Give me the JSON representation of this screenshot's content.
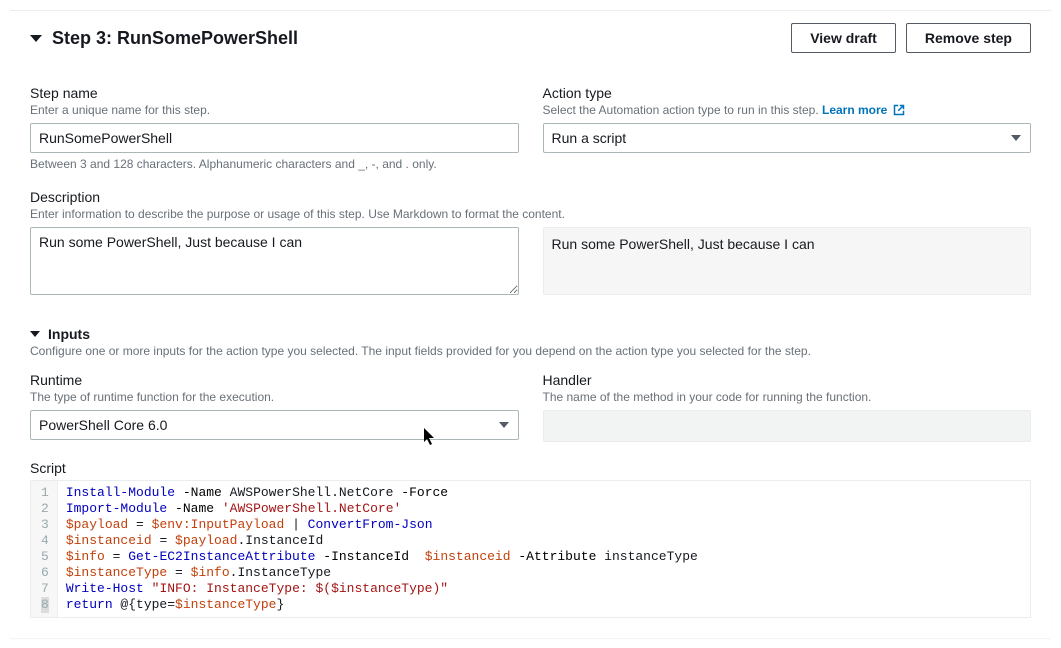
{
  "header": {
    "title": "Step 3: RunSomePowerShell",
    "view_draft_label": "View draft",
    "remove_step_label": "Remove step"
  },
  "step_name": {
    "label": "Step name",
    "hint": "Enter a unique name for this step.",
    "value": "RunSomePowerShell",
    "constraint": "Between 3 and 128 characters. Alphanumeric characters and _, -, and . only."
  },
  "action_type": {
    "label": "Action type",
    "hint_prefix": "Select the Automation action type to run in this step. ",
    "learn_more_label": "Learn more",
    "selected": "Run a script"
  },
  "description": {
    "label": "Description",
    "hint": "Enter information to describe the purpose or usage of this step. Use Markdown to format the content.",
    "value": "Run some PowerShell, Just because I can",
    "preview": "Run some PowerShell, Just because I can"
  },
  "inputs_section": {
    "title": "Inputs",
    "hint": "Configure one or more inputs for the action type you selected. The input fields provided for you depend on the action type you selected for the step."
  },
  "runtime": {
    "label": "Runtime",
    "hint": "The type of runtime function for the execution.",
    "selected": "PowerShell Core 6.0"
  },
  "handler": {
    "label": "Handler",
    "hint": "The name of the method in your code for running the function.",
    "value": ""
  },
  "script": {
    "label": "Script",
    "lines": [
      "Install-Module -Name AWSPowerShell.NetCore -Force",
      "Import-Module -Name 'AWSPowerShell.NetCore'",
      "$payload = $env:InputPayload | ConvertFrom-Json",
      "$instanceid = $payload.InstanceId",
      "$info = Get-EC2InstanceAttribute -InstanceId  $instanceid -Attribute instanceType",
      "$instanceType = $info.InstanceType",
      "Write-Host \"INFO: InstanceType: $($instanceType)\"",
      "return @{type=$instanceType}"
    ]
  }
}
